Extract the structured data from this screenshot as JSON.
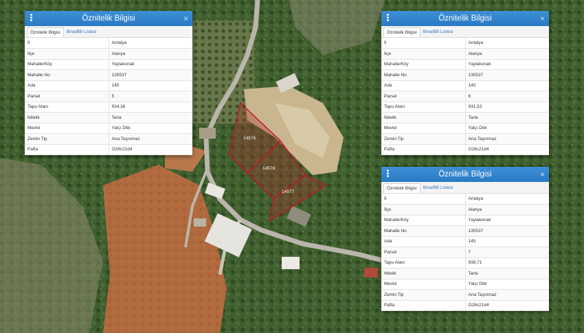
{
  "parcel_labels": [
    "14576",
    "14578",
    "14577"
  ],
  "panels": [
    {
      "title": "Öznitelik Bilgisi",
      "tabs": [
        "Öznitelik Bilgisi",
        "Bina/BB Listesi"
      ],
      "close": "×",
      "rows": [
        {
          "key": "İl",
          "value": "Antalya"
        },
        {
          "key": "İlçe",
          "value": "Alanya"
        },
        {
          "key": "Mahalle/Köy",
          "value": "Yaylakonak"
        },
        {
          "key": "Mahalle No",
          "value": "135537"
        },
        {
          "key": "Ada",
          "value": "145"
        },
        {
          "key": "Parsel",
          "value": "5"
        },
        {
          "key": "Tapu Alanı",
          "value": "934,36"
        },
        {
          "key": "Nitelik",
          "value": "Tarla"
        },
        {
          "key": "Mevkii",
          "value": "Yalçı Dibi"
        },
        {
          "key": "Zemin Tip",
          "value": "Ana Taşınmaz"
        },
        {
          "key": "Pafta",
          "value": "O28c21d4"
        }
      ]
    },
    {
      "title": "Öznitelik Bilgisi",
      "tabs": [
        "Öznitelik Bilgisi",
        "Bina/BB Listesi"
      ],
      "close": "×",
      "rows": [
        {
          "key": "İl",
          "value": "Antalya"
        },
        {
          "key": "İlçe",
          "value": "Alanya"
        },
        {
          "key": "Mahalle/Köy",
          "value": "Yaylakonak"
        },
        {
          "key": "Mahalle No",
          "value": "135537"
        },
        {
          "key": "Ada",
          "value": "145"
        },
        {
          "key": "Parsel",
          "value": "6"
        },
        {
          "key": "Tapu Alanı",
          "value": "931,53"
        },
        {
          "key": "Nitelik",
          "value": "Tarla"
        },
        {
          "key": "Mevkii",
          "value": "Yalçı Dibi"
        },
        {
          "key": "Zemin Tip",
          "value": "Ana Taşınmaz"
        },
        {
          "key": "Pafta",
          "value": "O28c21d4"
        }
      ]
    },
    {
      "title": "Öznitelik Bilgisi",
      "tabs": [
        "Öznitelik Bilgisi",
        "Bina/BB Listesi"
      ],
      "close": "×",
      "rows": [
        {
          "key": "İl",
          "value": "Antalya"
        },
        {
          "key": "İlçe",
          "value": "Alanya"
        },
        {
          "key": "Mahalle/Köy",
          "value": "Yaylakonak"
        },
        {
          "key": "Mahalle No",
          "value": "135537"
        },
        {
          "key": "Ada",
          "value": "145"
        },
        {
          "key": "Parsel",
          "value": "7"
        },
        {
          "key": "Tapu Alanı",
          "value": "938,71"
        },
        {
          "key": "Nitelik",
          "value": "Tarla"
        },
        {
          "key": "Mevkii",
          "value": "Yalçı Dibi"
        },
        {
          "key": "Zemin Tip",
          "value": "Ana Taşınmaz"
        },
        {
          "key": "Pafta",
          "value": "O28c21d4"
        }
      ]
    }
  ]
}
